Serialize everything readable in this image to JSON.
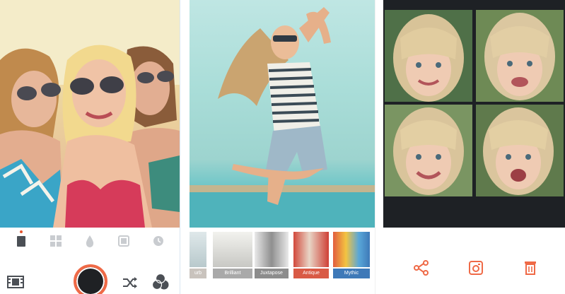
{
  "camera": {
    "modes": [
      "single-frame-icon",
      "grid-icon",
      "drop-icon",
      "square-frame-icon",
      "clock-icon"
    ],
    "selected_mode": 0,
    "bottom": [
      "film-strip-icon",
      "shutter-button",
      "shuffle-icon",
      "color-circles-icon"
    ],
    "colors": {
      "accent": "#ef6a47",
      "shutter": "#1f2124"
    }
  },
  "filters": {
    "items": [
      {
        "label": "urb",
        "color": "#c9c3bd"
      },
      {
        "label": "Brilliant",
        "color": "#a9a9a9"
      },
      {
        "label": "Juxtapose",
        "color": "#8c8c8c"
      },
      {
        "label": "Antique",
        "color": "#d95a45"
      },
      {
        "label": "Mythic",
        "color": "#3e79b8"
      }
    ]
  },
  "grid_view": {
    "actions": [
      "share-icon",
      "instagram-icon",
      "delete-icon"
    ],
    "colors": {
      "icon": "#ef6a47"
    }
  }
}
